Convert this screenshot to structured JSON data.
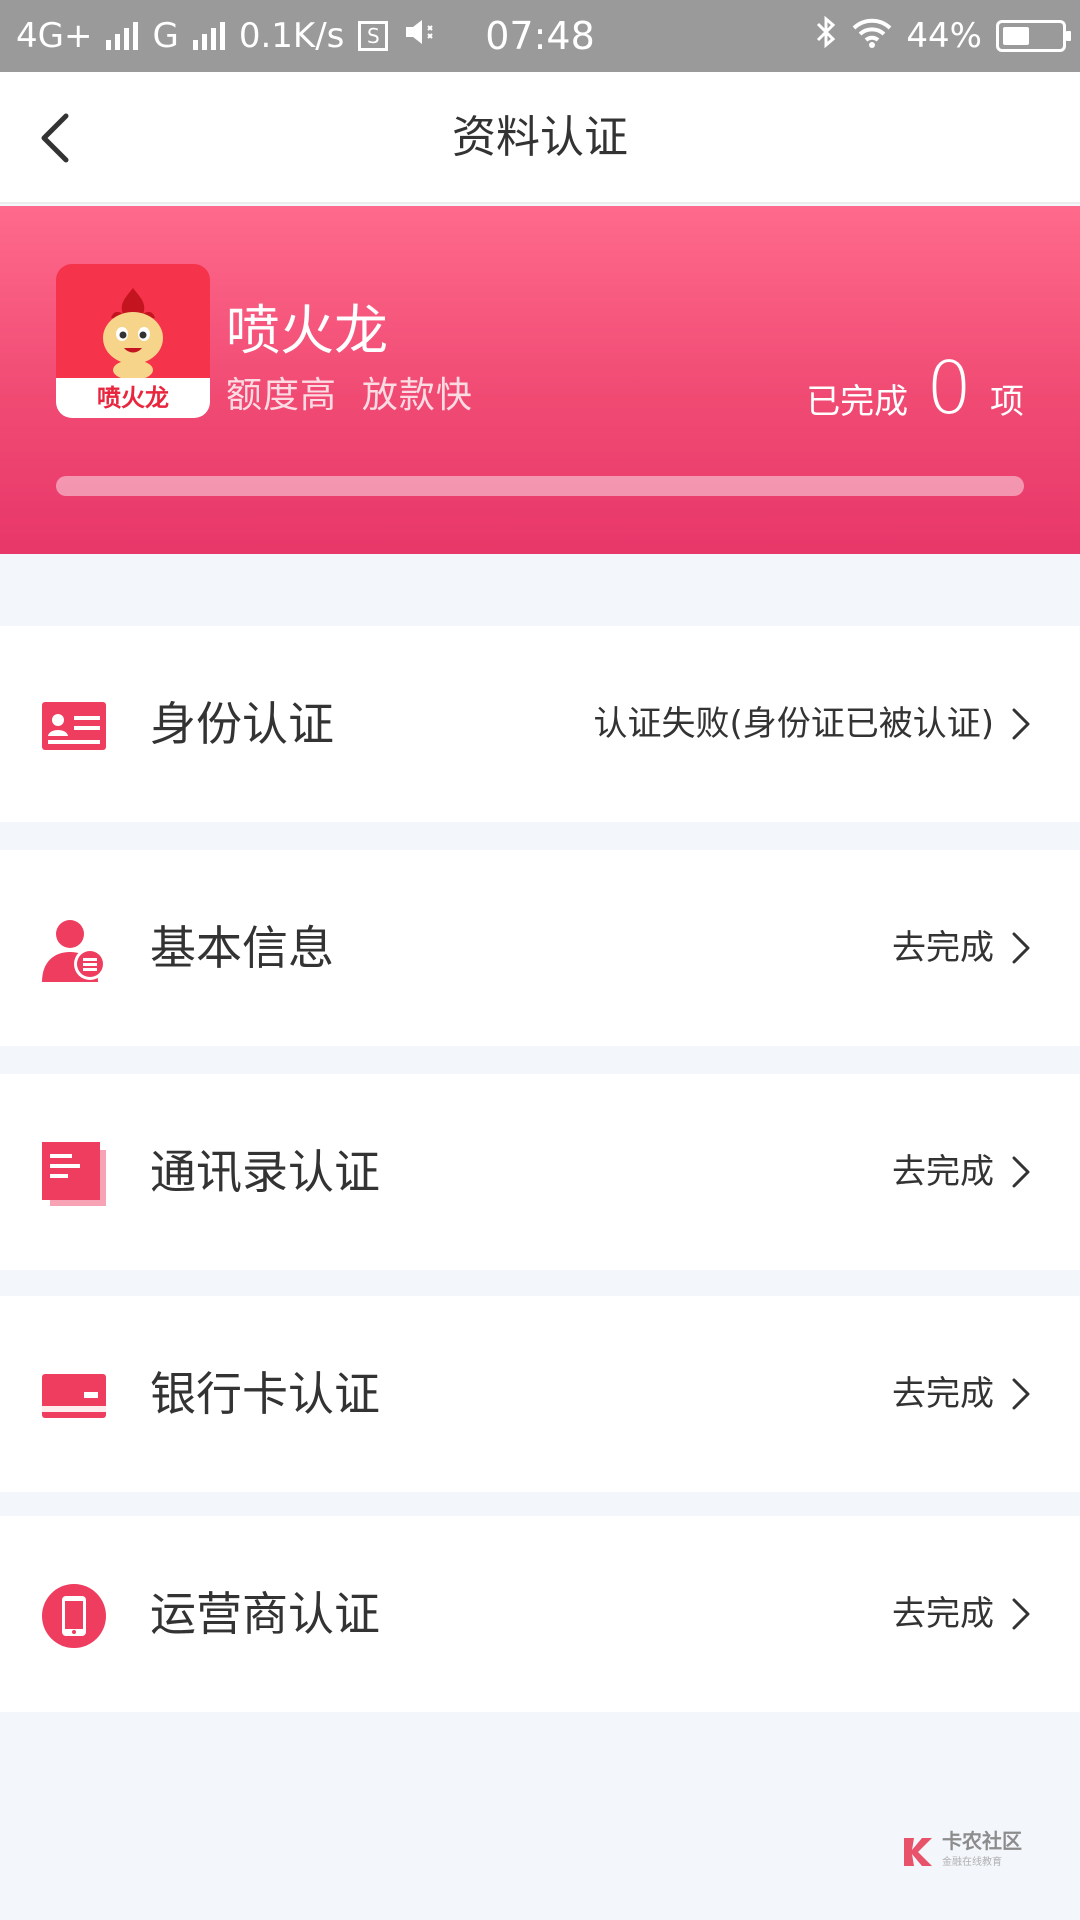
{
  "status_bar": {
    "network1": "4G+",
    "network2": "G",
    "speed": "0.1K/s",
    "time": "07:48",
    "battery": "44%"
  },
  "nav": {
    "title": "资料认证"
  },
  "hero": {
    "app_name": "喷火龙",
    "slogan": "额度高  放款快",
    "logo_text": "喷火龙",
    "done_prefix": "已完成",
    "done_count": "0",
    "done_suffix": "项",
    "progress": 0
  },
  "items": [
    {
      "label": "身份认证",
      "status": "认证失败(身份证已被认证)",
      "icon": "id-card-icon"
    },
    {
      "label": "基本信息",
      "status": "去完成",
      "icon": "user-info-icon"
    },
    {
      "label": "通讯录认证",
      "status": "去完成",
      "icon": "contacts-book-icon"
    },
    {
      "label": "银行卡认证",
      "status": "去完成",
      "icon": "bank-card-icon"
    },
    {
      "label": "运营商认证",
      "status": "去完成",
      "icon": "phone-icon"
    }
  ],
  "watermark": {
    "text": "卡农社区",
    "sub": "金融在线教育"
  },
  "colors": {
    "accent": "#f04a73",
    "icon": "#ee3d5e"
  }
}
